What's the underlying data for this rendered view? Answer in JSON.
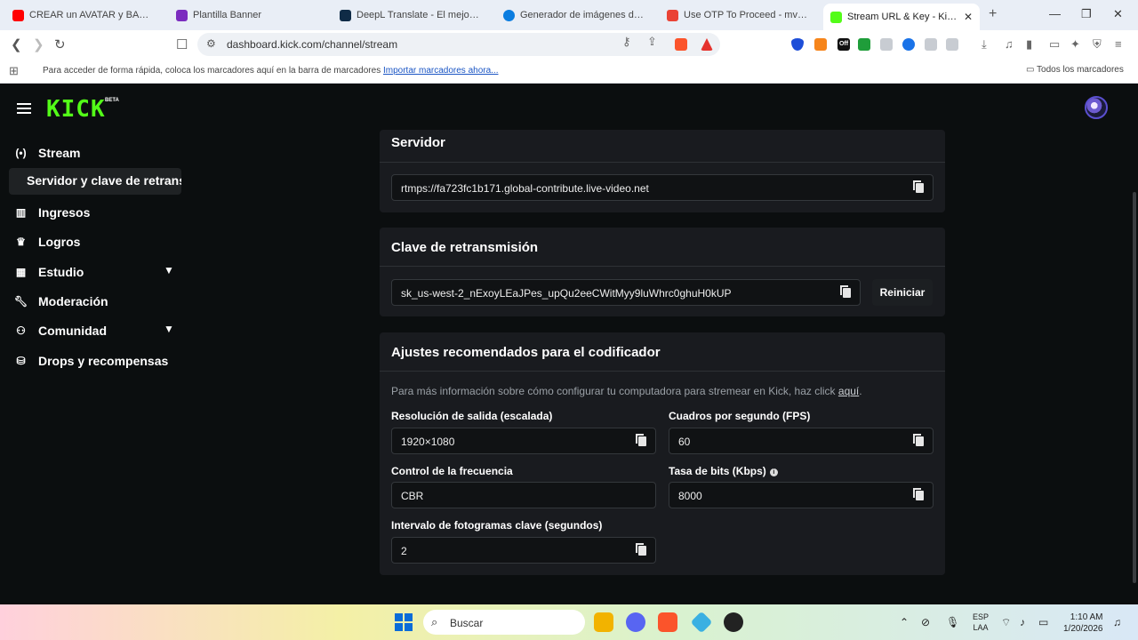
{
  "browser": {
    "tabs": [
      {
        "title": "CREAR un AVATAR y BANNER pa",
        "color": "#ff0000"
      },
      {
        "title": "Plantilla Banner",
        "color": "#7b2cbf"
      },
      {
        "title": "DeepL Translate - El mejor tradu",
        "color": "#0f2b46"
      },
      {
        "title": "Generador de imágenes de Bing",
        "color": "#0b7de0"
      },
      {
        "title": "Use OTP To Proceed - mvlazque",
        "color": "#ea4335"
      },
      {
        "title": "Stream URL & Key - Kick Da",
        "color": "#53fc18"
      }
    ],
    "url": "dashboard.kick.com/channel/stream",
    "bookmarks_message": "Para acceder de forma rápida, coloca los marcadores aquí en la barra de marcadores",
    "bookmarks_link": "Importar marcadores ahora...",
    "all_bookmarks": "Todos los marcadores",
    "ext_badge_off": "Off"
  },
  "app": {
    "logo": "KICK",
    "logo_badge": "BETA",
    "sidebar": {
      "items": [
        {
          "label": "Stream",
          "icon": "broadcast-icon"
        },
        {
          "label": "Servidor y clave de retransm",
          "icon": ""
        },
        {
          "label": "Ingresos",
          "icon": "chart-icon"
        },
        {
          "label": "Logros",
          "icon": "trophy-icon"
        },
        {
          "label": "Estudio",
          "icon": "studio-icon"
        },
        {
          "label": "Moderación",
          "icon": "wrench-icon"
        },
        {
          "label": "Comunidad",
          "icon": "community-icon"
        },
        {
          "label": "Drops y recompensas",
          "icon": "drops-icon"
        }
      ]
    },
    "server": {
      "title": "Servidor",
      "url": "rtmps://fa723fc1b171.global-contribute.live-video.net"
    },
    "stream_key": {
      "title": "Clave de retransmisión",
      "key": "sk_us-west-2_nExoyLEaJPes_upQu2eeCWitMyy9luWhrc0ghuH0kUP",
      "reset_label": "Reiniciar"
    },
    "encoder": {
      "title": "Ajustes recomendados para el codificador",
      "note": "Para más información sobre cómo configurar tu computadora para stremear en Kick, haz click ",
      "note_link": "aquí",
      "resolution_label": "Resolución de salida (escalada)",
      "resolution": "1920×1080",
      "fps_label": "Cuadros por segundo (FPS)",
      "fps": "60",
      "rate_control_label": "Control de la frecuencia",
      "rate_control": "CBR",
      "bitrate_label": "Tasa de bits (Kbps)",
      "bitrate": "8000",
      "keyframe_label": "Intervalo de fotogramas clave (segundos)",
      "keyframe": "2"
    }
  },
  "taskbar": {
    "search_placeholder": "Buscar",
    "lang_1": "ESP",
    "lang_2": "LAA",
    "time": "1:10 AM",
    "date": "1/20/2026"
  }
}
